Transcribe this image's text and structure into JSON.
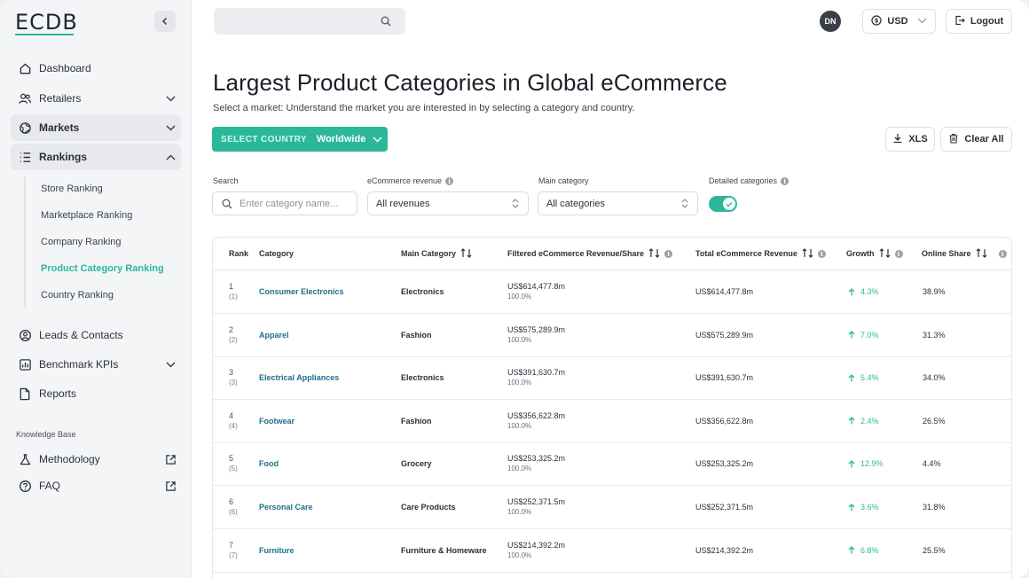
{
  "brand": {
    "name": "ECDB",
    "accent": "#2bb89a"
  },
  "sidebar": {
    "items": [
      {
        "label": "Dashboard",
        "icon": "home-icon"
      },
      {
        "label": "Retailers",
        "icon": "users-icon"
      },
      {
        "label": "Markets",
        "icon": "globe-icon"
      },
      {
        "label": "Rankings",
        "icon": "list-icon"
      }
    ],
    "rankings_sub": [
      "Store Ranking",
      "Marketplace Ranking",
      "Company Ranking",
      "Product Category Ranking",
      "Country Ranking"
    ],
    "lower_items": [
      {
        "label": "Leads & Contacts",
        "icon": "user-circle-icon"
      },
      {
        "label": "Benchmark KPIs",
        "icon": "chart-icon"
      },
      {
        "label": "Reports",
        "icon": "document-icon"
      }
    ],
    "kb_heading": "Knowledge Base",
    "kb_items": [
      {
        "label": "Methodology",
        "icon": "flask-icon"
      },
      {
        "label": "FAQ",
        "icon": "question-icon"
      }
    ]
  },
  "topbar": {
    "search_placeholder": "",
    "avatar_initials": "DN",
    "currency": "USD",
    "logout_label": "Logout"
  },
  "page": {
    "title": "Largest Product Categories in Global eCommerce",
    "subtitle": "Select a market: Understand the market you are interested in by selecting a category and country.",
    "country_key": "SELECT COUNTRY",
    "country_value": "Worldwide",
    "xls_label": "XLS",
    "clear_label": "Clear All"
  },
  "filters": {
    "search_label": "Search",
    "search_placeholder": "Enter category name...",
    "revenue_label": "eCommerce revenue",
    "revenue_value": "All revenues",
    "category_label": "Main category",
    "category_value": "All categories",
    "detailed_label": "Detailed categories",
    "detailed_on": true
  },
  "table": {
    "headers": {
      "rank": "Rank",
      "category": "Category",
      "main_category": "Main Category",
      "filtered": "Filtered eCommerce Revenue/Share",
      "total": "Total eCommerce Revenue",
      "growth": "Growth",
      "share": "Online Share"
    },
    "rows": [
      {
        "rank": "1",
        "prev": "(1)",
        "category": "Consumer Electronics",
        "main": "Electronics",
        "filtered": "US$614,477.8m",
        "filtered_share": "100.0%",
        "total": "US$614,477.8m",
        "growth": "4.3%",
        "share": "38.9%"
      },
      {
        "rank": "2",
        "prev": "(2)",
        "category": "Apparel",
        "main": "Fashion",
        "filtered": "US$575,289.9m",
        "filtered_share": "100.0%",
        "total": "US$575,289.9m",
        "growth": "7.0%",
        "share": "31.3%"
      },
      {
        "rank": "3",
        "prev": "(3)",
        "category": "Electrical Appliances",
        "main": "Electronics",
        "filtered": "US$391,630.7m",
        "filtered_share": "100.0%",
        "total": "US$391,630.7m",
        "growth": "5.4%",
        "share": "34.0%"
      },
      {
        "rank": "4",
        "prev": "(4)",
        "category": "Footwear",
        "main": "Fashion",
        "filtered": "US$356,622.8m",
        "filtered_share": "100.0%",
        "total": "US$356,622.8m",
        "growth": "2.4%",
        "share": "26.5%"
      },
      {
        "rank": "5",
        "prev": "(5)",
        "category": "Food",
        "main": "Grocery",
        "filtered": "US$253,325.2m",
        "filtered_share": "100.0%",
        "total": "US$253,325.2m",
        "growth": "12.9%",
        "share": "4.4%"
      },
      {
        "rank": "6",
        "prev": "(6)",
        "category": "Personal Care",
        "main": "Care Products",
        "filtered": "US$252,371.5m",
        "filtered_share": "100.0%",
        "total": "US$252,371.5m",
        "growth": "3.6%",
        "share": "31.8%"
      },
      {
        "rank": "7",
        "prev": "(7)",
        "category": "Furniture",
        "main": "Furniture & Homeware",
        "filtered": "US$214,392.2m",
        "filtered_share": "100.0%",
        "total": "US$214,392.2m",
        "growth": "6.8%",
        "share": "25.5%"
      }
    ]
  }
}
